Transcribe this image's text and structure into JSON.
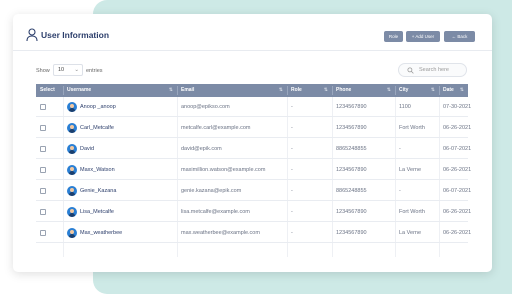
{
  "header": {
    "title": "User Information",
    "buttons": {
      "role": "Role",
      "add_user": "+ Add User",
      "back": "← Back"
    }
  },
  "controls": {
    "show_label": "Show",
    "entries_value": "10",
    "entries_label": "entries",
    "search_placeholder": "Search here"
  },
  "table": {
    "columns": [
      "Select",
      "Username",
      "Email",
      "Role",
      "Phone",
      "City",
      "Date"
    ],
    "rows": [
      {
        "username": "Anoop _anoop",
        "email": "anoop@epikso.com",
        "role": "-",
        "phone": "1234567890",
        "city": "1100",
        "date": "07-30-2021"
      },
      {
        "username": "Carl_Metcalfe",
        "email": "metcalfe.carl@example.com",
        "role": "-",
        "phone": "1234567890",
        "city": "Fort Worth",
        "date": "06-26-2021"
      },
      {
        "username": "David",
        "email": "david@epik.com",
        "role": "-",
        "phone": "8865248855",
        "city": "-",
        "date": "06-07-2021"
      },
      {
        "username": "Maxx_Watson",
        "email": "maximillion.watson@example.com",
        "role": "-",
        "phone": "1234567890",
        "city": "La Verne",
        "date": "06-26-2021"
      },
      {
        "username": "Genie_Kazana",
        "email": "genie.kazana@epik.com",
        "role": "-",
        "phone": "8865248855",
        "city": "-",
        "date": "06-07-2021"
      },
      {
        "username": "Lisa_Metcalfe",
        "email": "lisa.metcalfe@example.com",
        "role": "-",
        "phone": "1234567890",
        "city": "Fort Worth",
        "date": "06-26-2021"
      },
      {
        "username": "Max_weatherbee",
        "email": "max.weatherbee@example.com",
        "role": "-",
        "phone": "1234567890",
        "city": "La Verne",
        "date": "06-26-2021"
      }
    ]
  },
  "colors": {
    "accent": "#7c8ba6",
    "title": "#2c3e6b",
    "background_panel": "#cde9e6"
  },
  "icons": {
    "header": "user-icon",
    "search": "search-icon",
    "avatar": "avatar-icon",
    "sort": "sort-icon"
  }
}
